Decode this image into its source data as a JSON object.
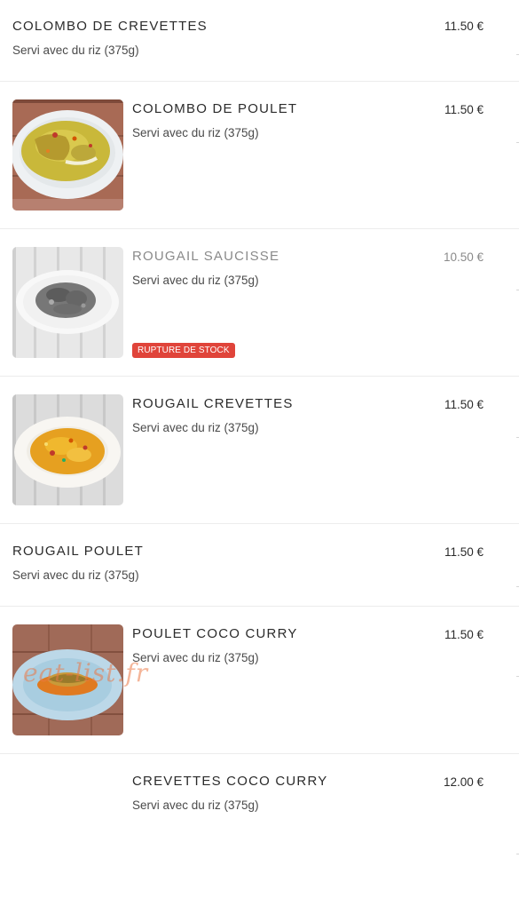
{
  "menu": {
    "items": [
      {
        "name": "COLOMBO DE CREVETTES",
        "description": "Servi avec du riz (375g)",
        "price": "11.50 €"
      },
      {
        "name": "COLOMBO DE POULET",
        "description": "Servi avec du riz (375g)",
        "price": "11.50 €",
        "image": "yellow-curry-chicken"
      },
      {
        "name": "ROUGAIL SAUCISSE",
        "description": "Servi avec du riz (375g)",
        "price": "10.50 €",
        "image": "sausage-rougail-grayscale",
        "badge": "RUPTURE DE STOCK"
      },
      {
        "name": "ROUGAIL CREVETTES",
        "description": "Servi avec du riz (375g)",
        "price": "11.50 €",
        "image": "shrimp-rougail"
      },
      {
        "name": "ROUGAIL POULET",
        "description": "Servi avec du riz (375g)",
        "price": "11.50 €"
      },
      {
        "name": "POULET COCO CURRY",
        "description": "Servi avec du riz (375g)",
        "price": "11.50 €",
        "image": "coconut-curry-chicken",
        "watermark": "eat-list.fr"
      },
      {
        "name": "CREVETTES COCO CURRY",
        "description": "Servi avec du riz (375g)",
        "price": "12.00 €"
      }
    ]
  },
  "colors": {
    "badge": "#e0443a",
    "divider": "#ececec",
    "text": "#2b2b2b",
    "muted": "#8a8a8a"
  }
}
